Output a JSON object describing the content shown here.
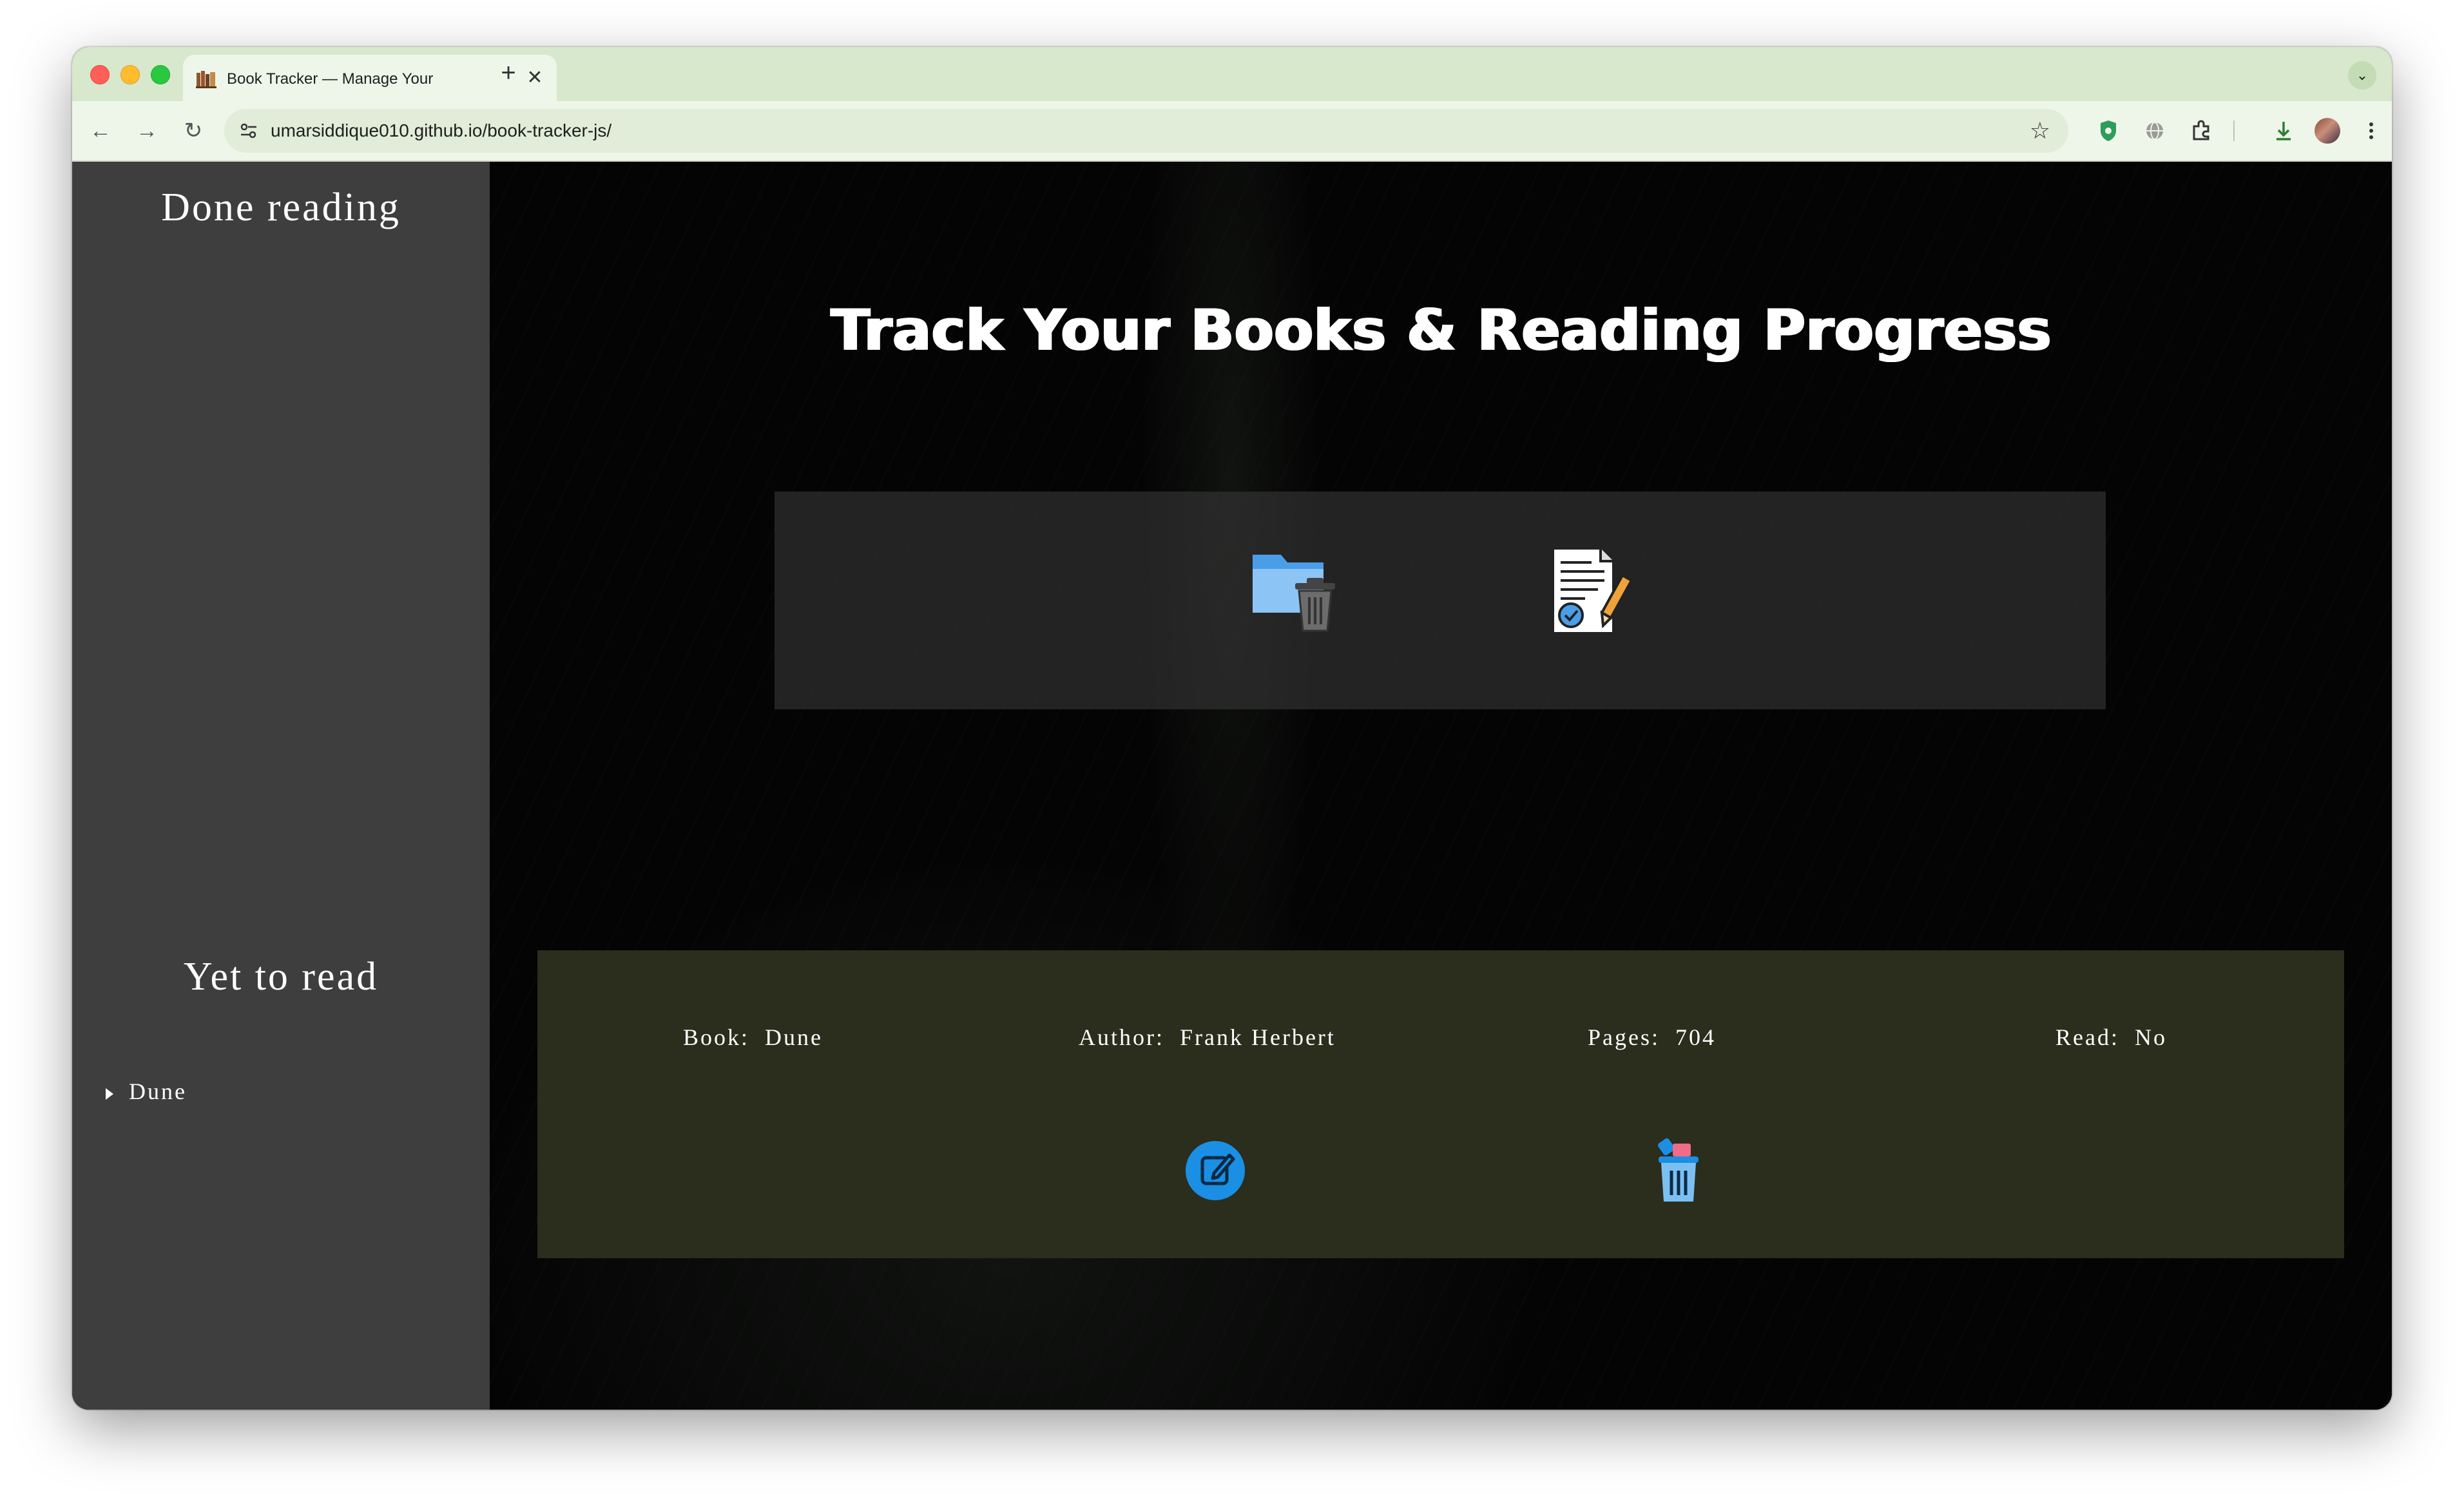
{
  "browser": {
    "tab_title": "Book Tracker — Manage Your",
    "tab_close": "✕",
    "new_tab": "+",
    "tab_menu": "⌄",
    "url": "umarsiddique010.github.io/book-tracker-js/",
    "back": "←",
    "forward": "→",
    "reload": "↻",
    "star": "☆"
  },
  "sidebar": {
    "done_heading": "Done reading",
    "yet_heading": "Yet to read",
    "yet_items": [
      {
        "label": "Dune"
      }
    ]
  },
  "main": {
    "title": "Track Your Books & Reading Progress",
    "actions": [
      {
        "icon": "folder-trash-icon"
      },
      {
        "icon": "add-document-icon"
      }
    ],
    "book": {
      "book_label": "Book:",
      "book": "Dune",
      "author_label": "Author:",
      "author": "Frank Herbert",
      "pages_label": "Pages:",
      "pages": "704",
      "read_label": "Read:",
      "read": "No"
    }
  },
  "colors": {
    "tabstrip": "#d7e8cd",
    "sidebar": "#3e3e3e",
    "card": "#2b2d1d",
    "edit_button": "#1a8fe3"
  }
}
